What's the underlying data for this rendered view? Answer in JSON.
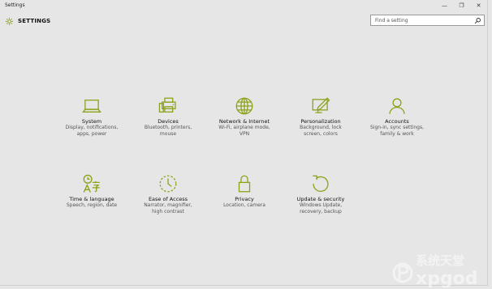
{
  "window": {
    "title": "Settings",
    "minimize": "—",
    "maximize": "❐",
    "close": "✕"
  },
  "header": {
    "title": "SETTINGS",
    "icon": "gear-icon"
  },
  "search": {
    "placeholder": "Find a setting",
    "icon": "search-icon"
  },
  "accent": "#8aa31a",
  "tiles": [
    {
      "name": "System",
      "desc1": "Display, notifications,",
      "desc2": "apps, power",
      "icon": "laptop-icon"
    },
    {
      "name": "Devices",
      "desc1": "Bluetooth, printers,",
      "desc2": "mouse",
      "icon": "devices-icon"
    },
    {
      "name": "Network & Internet",
      "desc1": "Wi-Fi, airplane mode,",
      "desc2": "VPN",
      "icon": "globe-icon"
    },
    {
      "name": "Personalization",
      "desc1": "Background, lock",
      "desc2": "screen, colors",
      "icon": "personalization-icon"
    },
    {
      "name": "Accounts",
      "desc1": "Sign-in, sync settings,",
      "desc2": "family & work",
      "icon": "person-icon"
    },
    {
      "name": "Time & language",
      "desc1": "Speech, region, date",
      "desc2": "",
      "icon": "time-language-icon"
    },
    {
      "name": "Ease of Access",
      "desc1": "Narrator, magnifier,",
      "desc2": "high contrast",
      "icon": "ease-of-access-icon"
    },
    {
      "name": "Privacy",
      "desc1": "Location, camera",
      "desc2": "",
      "icon": "lock-icon"
    },
    {
      "name": "Update & security",
      "desc1": "Windows Update,",
      "desc2": "recovery, backup",
      "icon": "update-icon"
    }
  ],
  "watermark": {
    "line1": "系统天堂",
    "line2": "xpgod"
  }
}
